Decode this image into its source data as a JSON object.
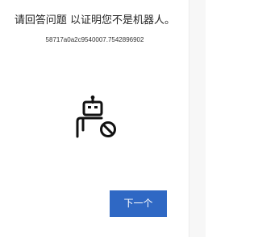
{
  "challenge": {
    "prompt": "请回答问题 以证明您不是机器人。",
    "session_id": "58717a0a2c9540007.7542896902",
    "illustration_icon": "robot-blocked-icon"
  },
  "actions": {
    "next_label": "下一个"
  },
  "colors": {
    "primary_button": "#2f68c4",
    "text": "#1f1f1f",
    "icon": "#111111"
  }
}
